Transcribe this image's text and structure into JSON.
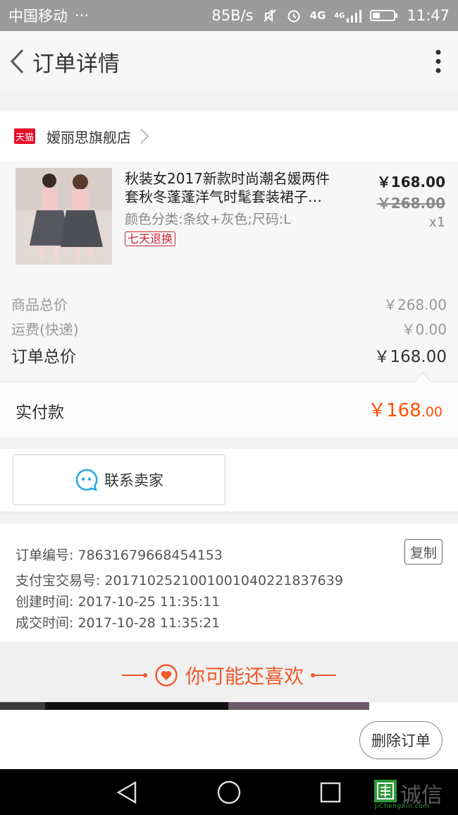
{
  "status_bar": {
    "carrier": "中国移动",
    "dots": "···",
    "speed": "85B/s",
    "network": "4G",
    "network2": "4G",
    "time": "11:47"
  },
  "nav": {
    "title": "订单详情"
  },
  "shop": {
    "badge": "天猫",
    "name": "嫒丽思旗舰店"
  },
  "item": {
    "title_line1": "秋装女2017新款时尚潮名媛两件",
    "title_line2": "套秋冬蓬蓬洋气时髦套装裙子…",
    "spec": "颜色分类:条纹+灰色;尺码:L",
    "return_badge": "七天退换",
    "price_now": "￥168.00",
    "price_old": "￥268.00",
    "quantity": "x1"
  },
  "prices": {
    "goods_total_label": "商品总价",
    "goods_total_value": "￥268.00",
    "shipping_label": "运费(快递)",
    "shipping_value": "￥0.00",
    "order_total_label": "订单总价",
    "order_total_value": "￥168.00",
    "paid_label": "实付款",
    "paid_value_main": "￥168",
    "paid_value_decimal": ".00",
    "accent_color": "#ff5000"
  },
  "contact": {
    "label": "联系卖家"
  },
  "order_info": {
    "order_no_label": "订单编号:",
    "order_no": "78631679668454153",
    "alipay_label": "支付宝交易号:",
    "alipay_no": "2017102521001001040221837639",
    "created_label": "创建时间:",
    "created_time": "2017-10-25 11:35:11",
    "closed_label": "成交时间:",
    "closed_time": "2017-10-28 11:35:21",
    "copy_label": "复制"
  },
  "recommend": {
    "title": "你可能还喜欢"
  },
  "actions": {
    "delete_label": "删除订单"
  },
  "watermark": {
    "text": "诚信",
    "sub": "JiChengXin.com"
  }
}
